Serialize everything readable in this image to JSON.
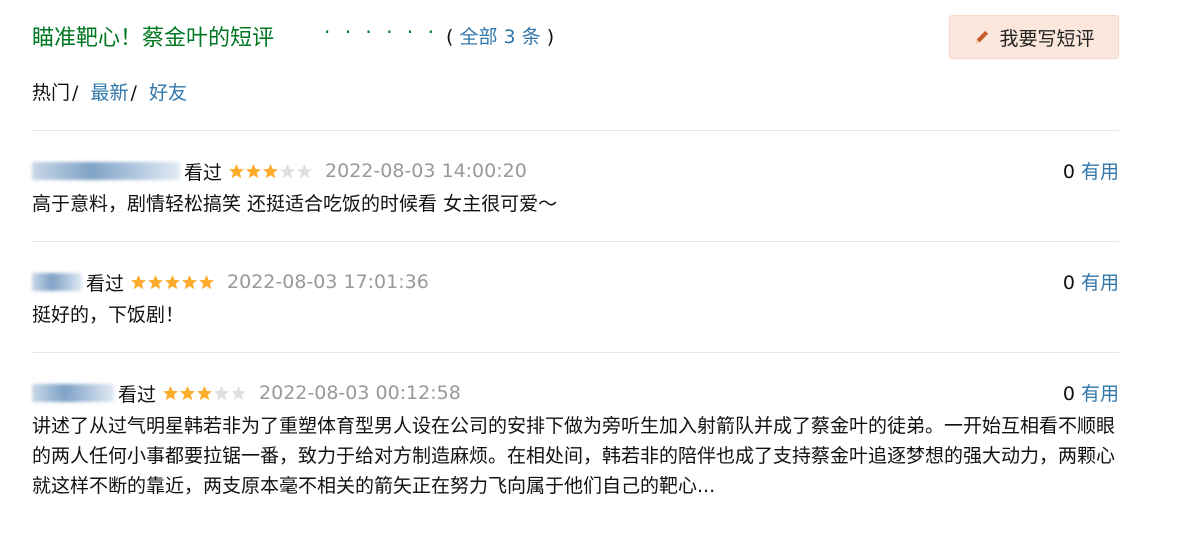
{
  "header": {
    "title": "瞄准靶心！蔡金叶的短评",
    "dots": "· · · · · ·",
    "count_open": "(",
    "count_link": "全部 3 条",
    "count_close": ")",
    "write_button": "我要写短评"
  },
  "tabs": {
    "hot": "热门",
    "sep": "/",
    "latest": "最新",
    "friends": "好友"
  },
  "comments": [
    {
      "status": "看过",
      "rating": 3,
      "max_rating": 5,
      "time": "2022-08-03 14:00:20",
      "votes": "0",
      "useful_label": "有用",
      "text": "高于意料，剧情轻松搞笑 还挺适合吃饭的时候看 女主很可爱～"
    },
    {
      "status": "看过",
      "rating": 5,
      "max_rating": 5,
      "time": "2022-08-03 17:01:36",
      "votes": "0",
      "useful_label": "有用",
      "text": "挺好的，下饭剧！"
    },
    {
      "status": "看过",
      "rating": 3,
      "max_rating": 5,
      "time": "2022-08-03 00:12:58",
      "votes": "0",
      "useful_label": "有用",
      "text": "讲述了从过气明星韩若非为了重塑体育型男人设在公司的安排下做为旁听生加入射箭队并成了蔡金叶的徒弟。一开始互相看不顺眼的两人任何小事都要拉锯一番，致力于给对方制造麻烦。在相处间，韩若非的陪伴也成了支持蔡金叶追逐梦想的强大动力，两颗心就这样不断的靠近，两支原本毫不相关的箭矢正在努力飞向属于他们自己的靶心..."
    }
  ],
  "colors": {
    "title_green": "#007722",
    "link_blue": "#3377aa",
    "star_on": "#ffac2d",
    "star_off": "#e0e0e0",
    "time_gray": "#999999",
    "button_bg": "#fbe7dc"
  },
  "icons": {
    "write": "pencil-icon",
    "star": "star-icon"
  }
}
